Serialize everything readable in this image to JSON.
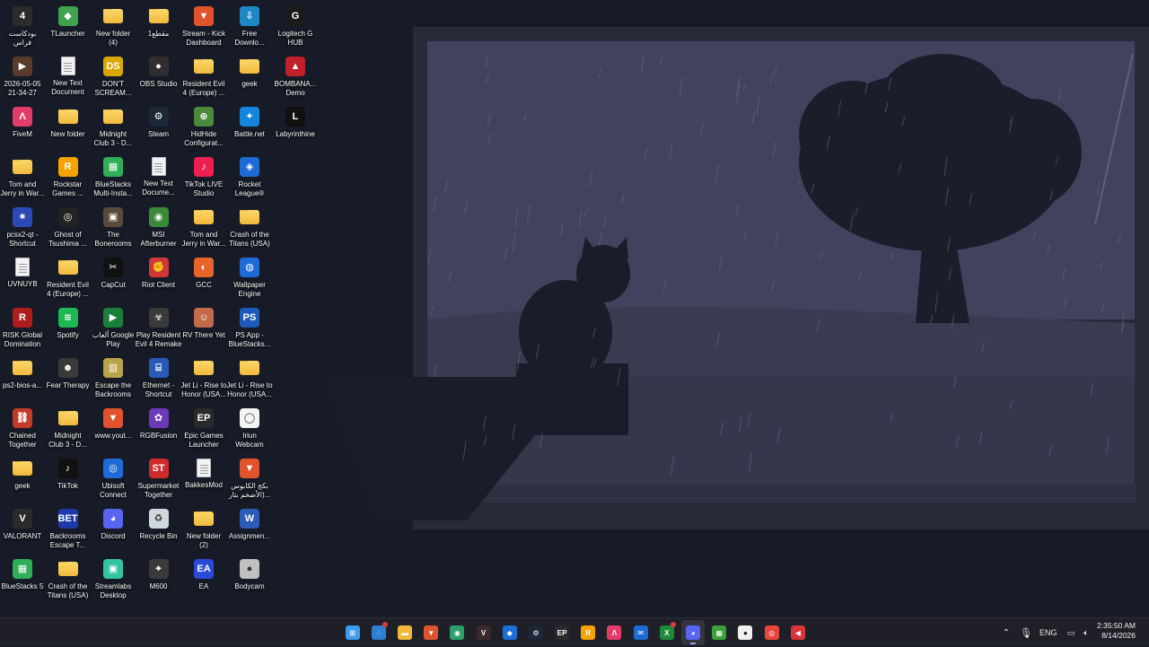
{
  "colors": {
    "sky": "#40425d",
    "ground": "#383a4f",
    "silhouette": "#1b1c2a",
    "backdrop": "#161a26",
    "taskbar": "#1f1f27"
  },
  "desktop_icons": [
    {
      "id": "podcast",
      "label": "بودكاست\nفراس",
      "icon": "image-icon",
      "color": "#2b2b2b",
      "glyph": "4",
      "col": 0,
      "row": 0
    },
    {
      "id": "tlauncher",
      "label": "TLauncher",
      "icon": "tlauncher-icon",
      "color": "#3fa34d",
      "glyph": "◆",
      "col": 1,
      "row": 0
    },
    {
      "id": "newfolder4",
      "label": "New folder\n(4)",
      "icon": "folder-icon",
      "type": "folder",
      "col": 2,
      "row": 0
    },
    {
      "id": "clip1",
      "label": "مقطع1",
      "icon": "folder-icon",
      "type": "folder",
      "col": 3,
      "row": 0
    },
    {
      "id": "kick",
      "label": "Stream - Kick\nDashboard",
      "icon": "brave-icon",
      "color": "#e0532c",
      "glyph": "▼",
      "col": 4,
      "row": 0
    },
    {
      "id": "freedownload",
      "label": "Free\nDownlo...",
      "icon": "download-manager-icon",
      "color": "#1e88c7",
      "glyph": "⇩",
      "col": 5,
      "row": 0
    },
    {
      "id": "logitech",
      "label": "Logitech G\nHUB",
      "icon": "logitech-icon",
      "color": "#1a1a1a",
      "glyph": "G",
      "col": 6,
      "row": 0
    },
    {
      "id": "vid0505",
      "label": "2026-05-05\n21-34-27",
      "icon": "video-icon",
      "color": "#5a3a2a",
      "glyph": "▶",
      "col": 0,
      "row": 1
    },
    {
      "id": "newtext1",
      "label": "New Text\nDocument",
      "icon": "text-document-icon",
      "type": "doc",
      "col": 1,
      "row": 1
    },
    {
      "id": "dontscream",
      "label": "DON'T\nSCREAM...",
      "icon": "dont-scream-icon",
      "color": "#d9a800",
      "glyph": "DS",
      "col": 2,
      "row": 1
    },
    {
      "id": "obs",
      "label": "OBS Studio",
      "icon": "obs-icon",
      "color": "#302e31",
      "glyph": "●",
      "col": 3,
      "row": 1
    },
    {
      "id": "re4europe1",
      "label": "Resident Evil\n4 (Europe) ...",
      "icon": "folder-icon",
      "type": "folder",
      "col": 4,
      "row": 1
    },
    {
      "id": "geek1",
      "label": "geek",
      "icon": "folder-icon",
      "type": "folder",
      "col": 5,
      "row": 1
    },
    {
      "id": "bombana",
      "label": "BOMBANA...\nDemo",
      "icon": "car-icon",
      "color": "#c0202a",
      "glyph": "▲",
      "col": 6,
      "row": 1
    },
    {
      "id": "fivem",
      "label": "FiveM",
      "icon": "fivem-icon",
      "color": "#e23c6b",
      "glyph": "Λ",
      "col": 0,
      "row": 2
    },
    {
      "id": "newfolder",
      "label": "New folder",
      "icon": "folder-icon",
      "type": "folder",
      "col": 1,
      "row": 2
    },
    {
      "id": "midnight1",
      "label": "Midnight\nClub 3 - D...",
      "icon": "folder-icon",
      "type": "folder",
      "col": 2,
      "row": 2
    },
    {
      "id": "steam",
      "label": "Steam",
      "icon": "steam-icon",
      "color": "#1b2838",
      "glyph": "⚙",
      "col": 3,
      "row": 2
    },
    {
      "id": "hidhide",
      "label": "HidHide\nConfigurat...",
      "icon": "controller-icon",
      "color": "#4a8a3a",
      "glyph": "⊕",
      "col": 4,
      "row": 2
    },
    {
      "id": "battlenet",
      "label": "Battle.net",
      "icon": "battlenet-icon",
      "color": "#1386dc",
      "glyph": "✦",
      "col": 5,
      "row": 2
    },
    {
      "id": "labyrinthine",
      "label": "Labyrinthine",
      "icon": "labyrinthine-icon",
      "color": "#111111",
      "glyph": "L",
      "col": 6,
      "row": 2
    },
    {
      "id": "tomjerry1",
      "label": "Tom and\nJerry in War...",
      "icon": "folder-icon",
      "type": "folder",
      "col": 0,
      "row": 3
    },
    {
      "id": "rockstar",
      "label": "Rockstar\nGames ...",
      "icon": "rockstar-icon",
      "color": "#f5a300",
      "glyph": "R",
      "col": 1,
      "row": 3
    },
    {
      "id": "bluestacksmulti",
      "label": "BlueStacks\nMulti-Insta...",
      "icon": "bluestacks-icon",
      "color": "#2fae58",
      "glyph": "▦",
      "col": 2,
      "row": 3
    },
    {
      "id": "newtext2",
      "label": "New Text\nDocume...",
      "icon": "text-document-icon",
      "type": "doc",
      "col": 3,
      "row": 3
    },
    {
      "id": "tiktoklive",
      "label": "TikTok LIVE\nStudio",
      "icon": "tiktok-live-icon",
      "color": "#ee1d52",
      "glyph": "♪",
      "col": 4,
      "row": 3
    },
    {
      "id": "rocketleague",
      "label": "Rocket\nLeague®",
      "icon": "rocket-league-icon",
      "color": "#1e6ad6",
      "glyph": "◈",
      "col": 5,
      "row": 3
    },
    {
      "id": "pcsx2",
      "label": "pcsx2-qt -\nShortcut",
      "icon": "pcsx2-icon",
      "color": "#2b4ab8",
      "glyph": "✷",
      "col": 0,
      "row": 4
    },
    {
      "id": "ghost",
      "label": "Ghost of\nTsushima ...",
      "icon": "ghost-icon",
      "color": "#222222",
      "glyph": "◎",
      "col": 1,
      "row": 4
    },
    {
      "id": "bonerooms",
      "label": "The\nBonerooms",
      "icon": "bonerooms-icon",
      "color": "#5a4a3a",
      "glyph": "▣",
      "col": 2,
      "row": 4
    },
    {
      "id": "msi",
      "label": "MSI\nAfterburner",
      "icon": "msi-icon",
      "color": "#3a8a3a",
      "glyph": "◉",
      "col": 3,
      "row": 4
    },
    {
      "id": "tomjerry2",
      "label": "Tom and\nJerry in War...",
      "icon": "folder-icon",
      "type": "folder",
      "col": 4,
      "row": 4
    },
    {
      "id": "crashtitans1",
      "label": "Crash of the\nTitans (USA)",
      "icon": "folder-icon",
      "type": "folder",
      "col": 5,
      "row": 4
    },
    {
      "id": "uvnuyb",
      "label": "UVNUYB",
      "icon": "text-document-icon",
      "type": "doc",
      "col": 0,
      "row": 5
    },
    {
      "id": "re4europe2",
      "label": "Resident Evil\n4 (Europe) ...",
      "icon": "folder-icon",
      "type": "folder",
      "col": 1,
      "row": 5
    },
    {
      "id": "capcut",
      "label": "CapCut",
      "icon": "capcut-icon",
      "color": "#111111",
      "glyph": "✂",
      "col": 2,
      "row": 5
    },
    {
      "id": "riot",
      "label": "Riot Client",
      "icon": "riot-icon",
      "color": "#d13639",
      "glyph": "✊",
      "col": 3,
      "row": 5
    },
    {
      "id": "gcc",
      "label": "GCC",
      "icon": "gcc-icon",
      "color": "#e8642a",
      "glyph": "◐",
      "col": 4,
      "row": 5
    },
    {
      "id": "wallpaperengine",
      "label": "Wallpaper\nEngine",
      "icon": "wallpaper-engine-icon",
      "color": "#1e6ad6",
      "glyph": "◍",
      "col": 5,
      "row": 5
    },
    {
      "id": "risk",
      "label": "RISK Global\nDomination",
      "icon": "risk-icon",
      "color": "#b01c1c",
      "glyph": "R",
      "col": 0,
      "row": 6
    },
    {
      "id": "spotify",
      "label": "Spotify",
      "icon": "spotify-icon",
      "color": "#1db954",
      "glyph": "≋",
      "col": 1,
      "row": 6
    },
    {
      "id": "googleplay",
      "label": "ألعاب Google\nPlay",
      "icon": "google-play-icon",
      "color": "#1a7f3a",
      "glyph": "▶",
      "col": 2,
      "row": 6
    },
    {
      "id": "playre4",
      "label": "Play Resident\nEvil 4 Remake",
      "icon": "resident-evil-icon",
      "color": "#3a3a3a",
      "glyph": "☣",
      "col": 3,
      "row": 6
    },
    {
      "id": "rvthere",
      "label": "RV There Yet",
      "icon": "rv-icon",
      "color": "#c26a4a",
      "glyph": "☺",
      "col": 4,
      "row": 6
    },
    {
      "id": "psapp",
      "label": "PS App -\nBlueStacks...",
      "icon": "playstation-icon",
      "color": "#1e5bb8",
      "glyph": "PS",
      "col": 5,
      "row": 6
    },
    {
      "id": "ps2bios",
      "label": "ps2-bios-a...",
      "icon": "folder-icon",
      "type": "folder",
      "col": 0,
      "row": 7
    },
    {
      "id": "feartherapy",
      "label": "Fear Therapy",
      "icon": "fear-therapy-icon",
      "color": "#3a3a3a",
      "glyph": "☻",
      "col": 1,
      "row": 7
    },
    {
      "id": "escapebackrooms",
      "label": "Escape the\nBackrooms",
      "icon": "backrooms-icon",
      "color": "#b8a24a",
      "glyph": "▥",
      "col": 2,
      "row": 7
    },
    {
      "id": "ethernet",
      "label": "Ethernet -\nShortcut",
      "icon": "network-icon",
      "color": "#2a5ab8",
      "glyph": "⌸",
      "col": 3,
      "row": 7
    },
    {
      "id": "jetli1",
      "label": "Jet Li - Rise to\nHonor (USA...",
      "icon": "folder-icon",
      "type": "folder",
      "col": 4,
      "row": 7
    },
    {
      "id": "jetli2",
      "label": "Jet Li - Rise to\nHonor (USA...",
      "icon": "folder-icon",
      "type": "folder",
      "col": 5,
      "row": 7
    },
    {
      "id": "chained",
      "label": "Chained\nTogether",
      "icon": "chained-icon",
      "color": "#c23a2a",
      "glyph": "⛓",
      "col": 0,
      "row": 8
    },
    {
      "id": "midnight2",
      "label": "Midnight\nClub 3 - D...",
      "icon": "folder-icon",
      "type": "folder",
      "col": 1,
      "row": 8
    },
    {
      "id": "youtube",
      "label": "www.yout...",
      "icon": "brave-icon",
      "color": "#e0532c",
      "glyph": "▼",
      "col": 2,
      "row": 8
    },
    {
      "id": "rgbfusion",
      "label": "RGBFusion",
      "icon": "rgb-icon",
      "color": "#6a3ab8",
      "glyph": "✿",
      "col": 3,
      "row": 8
    },
    {
      "id": "epic1",
      "label": "Epic Games\nLauncher",
      "icon": "epic-games-icon",
      "color": "#2a2a2a",
      "glyph": "EP",
      "col": 4,
      "row": 8
    },
    {
      "id": "iriun",
      "label": "Iriun\nWebcam",
      "icon": "webcam-icon",
      "color": "#f4f4f4",
      "glyph": "◯",
      "col": 5,
      "row": 8
    },
    {
      "id": "geek2",
      "label": "geek",
      "icon": "folder-icon",
      "type": "folder",
      "col": 0,
      "row": 9
    },
    {
      "id": "tiktok",
      "label": "TikTok",
      "icon": "tiktok-icon",
      "color": "#111111",
      "glyph": "♪",
      "col": 1,
      "row": 9
    },
    {
      "id": "ubisoft",
      "label": "Ubisoft\nConnect",
      "icon": "ubisoft-icon",
      "color": "#1e6ad6",
      "glyph": "◎",
      "col": 2,
      "row": 9
    },
    {
      "id": "supermarket",
      "label": "Supermarket\nTogether",
      "icon": "supermarket-icon",
      "color": "#d12a2a",
      "glyph": "ST",
      "col": 3,
      "row": 9
    },
    {
      "id": "bakkesmod",
      "label": "BakkesMod",
      "icon": "text-document-icon",
      "type": "doc",
      "col": 4,
      "row": 9
    },
    {
      "id": "brave2",
      "label": "بكج الكابوس\nالأضخم بتار)...",
      "icon": "brave-icon",
      "color": "#e0532c",
      "glyph": "▼",
      "col": 5,
      "row": 9
    },
    {
      "id": "valorant",
      "label": "VALORANT",
      "icon": "valorant-icon",
      "color": "#2a2a2a",
      "glyph": "V",
      "col": 0,
      "row": 10
    },
    {
      "id": "backroomsescape",
      "label": "Backrooms\nEscape T...",
      "icon": "backrooms-escape-icon",
      "color": "#1e3aa8",
      "glyph": "BET",
      "col": 1,
      "row": 10
    },
    {
      "id": "discord",
      "label": "Discord",
      "icon": "discord-icon",
      "color": "#5865f2",
      "glyph": "◕",
      "col": 2,
      "row": 10
    },
    {
      "id": "recyclebin",
      "label": "Recycle Bin",
      "icon": "recycle-bin-icon",
      "color": "#cfd8dc",
      "glyph": "♻",
      "col": 3,
      "row": 10
    },
    {
      "id": "newfolder2",
      "label": "New folder\n(2)",
      "icon": "folder-icon",
      "type": "folder",
      "col": 4,
      "row": 10
    },
    {
      "id": "assignment",
      "label": "Assignmen...",
      "icon": "word-document-icon",
      "color": "#2b5cb8",
      "glyph": "W",
      "col": 5,
      "row": 10
    },
    {
      "id": "bluestacks5",
      "label": "BlueStacks 5",
      "icon": "bluestacks-icon",
      "color": "#2fae58",
      "glyph": "▦",
      "col": 0,
      "row": 11
    },
    {
      "id": "crashtitans2",
      "label": "Crash of the\nTitans (USA)",
      "icon": "folder-icon",
      "type": "folder",
      "col": 1,
      "row": 11
    },
    {
      "id": "streamlabs",
      "label": "Streamlabs\nDesktop",
      "icon": "streamlabs-icon",
      "color": "#31c3a2",
      "glyph": "▣",
      "col": 2,
      "row": 11
    },
    {
      "id": "m600",
      "label": "M600",
      "icon": "mouse-icon",
      "color": "#3a3a3a",
      "glyph": "⌖",
      "col": 3,
      "row": 11
    },
    {
      "id": "ea",
      "label": "EA",
      "icon": "ea-icon",
      "color": "#2a4ad8",
      "glyph": "EA",
      "col": 4,
      "row": 11
    },
    {
      "id": "bodycam",
      "label": "Bodycam",
      "icon": "bodycam-icon",
      "color": "#c0c0c0",
      "glyph": "●",
      "col": 5,
      "row": 11
    }
  ],
  "taskbar": {
    "apps": [
      {
        "id": "start",
        "icon": "windows-start-icon",
        "color": "#3b9cf0",
        "glyph": "⊞"
      },
      {
        "id": "copilot",
        "icon": "copilot-icon",
        "color": "#2d7fd0",
        "glyph": "◌",
        "badge": true
      },
      {
        "id": "explorer",
        "icon": "file-explorer-icon",
        "color": "#f1b93a",
        "glyph": "▬"
      },
      {
        "id": "brave",
        "icon": "brave-icon",
        "color": "#e0532c",
        "glyph": "▼"
      },
      {
        "id": "gamebar",
        "icon": "controller-icon",
        "color": "#2aa06a",
        "glyph": "◉"
      },
      {
        "id": "valorant",
        "icon": "valorant-icon",
        "color": "#3a2a2e",
        "glyph": "V"
      },
      {
        "id": "bluestacks",
        "icon": "bluestacks-icon",
        "color": "#1d6fd8",
        "glyph": "◆"
      },
      {
        "id": "steam",
        "icon": "steam-icon",
        "color": "#1b2838",
        "glyph": "⚙"
      },
      {
        "id": "epic",
        "icon": "epic-games-icon",
        "color": "#2a2a2a",
        "glyph": "EP"
      },
      {
        "id": "rockstar",
        "icon": "rockstar-icon",
        "color": "#f5a300",
        "glyph": "R"
      },
      {
        "id": "fivem",
        "icon": "fivem-icon",
        "color": "#e23c6b",
        "glyph": "Λ"
      },
      {
        "id": "mail",
        "icon": "mail-icon",
        "color": "#1e6ad6",
        "glyph": "✉"
      },
      {
        "id": "xbox",
        "icon": "xbox-icon",
        "color": "#1e8a3a",
        "glyph": "X",
        "badge": true
      },
      {
        "id": "discord",
        "icon": "discord-icon",
        "color": "#5865f2",
        "glyph": "◕",
        "active": true
      },
      {
        "id": "minecraft",
        "icon": "minecraft-icon",
        "color": "#3aa13a",
        "glyph": "▦"
      },
      {
        "id": "obs",
        "icon": "obs-icon",
        "color": "#f0f0f0",
        "glyph": "●"
      },
      {
        "id": "chrome",
        "icon": "chrome-icon",
        "color": "#e8453c",
        "glyph": "◎"
      },
      {
        "id": "recorder",
        "icon": "screen-recorder-icon",
        "color": "#d8343a",
        "glyph": "◀"
      }
    ],
    "tray": {
      "language": "ENG",
      "time": "2:35:50 AM",
      "date": "8/14/2026"
    }
  }
}
